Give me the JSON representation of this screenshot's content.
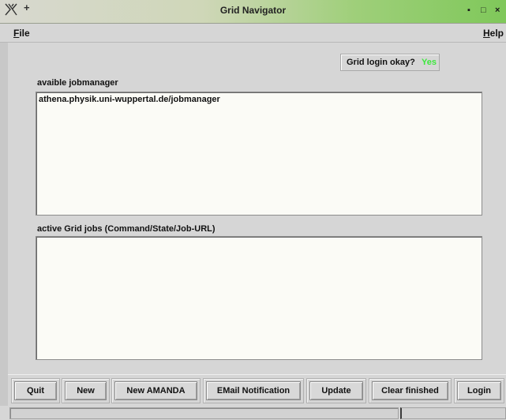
{
  "window": {
    "title": "Grid Navigator",
    "plus_glyph": "+",
    "min_glyph": "▪",
    "max_glyph": "□",
    "close_glyph": "×"
  },
  "menu": {
    "file_accel": "F",
    "file_rest": "ile",
    "help_accel": "H",
    "help_rest": "elp"
  },
  "login": {
    "label": "Grid login okay?",
    "value": "Yes",
    "value_color": "#3ee83e"
  },
  "jobmanager": {
    "label": "avaible jobmanager",
    "items": [
      "athena.physik.uni-wuppertal.de/jobmanager"
    ]
  },
  "active_jobs": {
    "label": "active Grid jobs (Command/State/Job-URL)",
    "items": []
  },
  "buttons": {
    "quit": "Quit",
    "new": "New",
    "new_amanda": "New AMANDA",
    "email_notification": "EMail Notification",
    "update": "Update",
    "clear_finished": "Clear finished",
    "login": "Login"
  },
  "status": {
    "left_text": "",
    "right_text": ""
  }
}
